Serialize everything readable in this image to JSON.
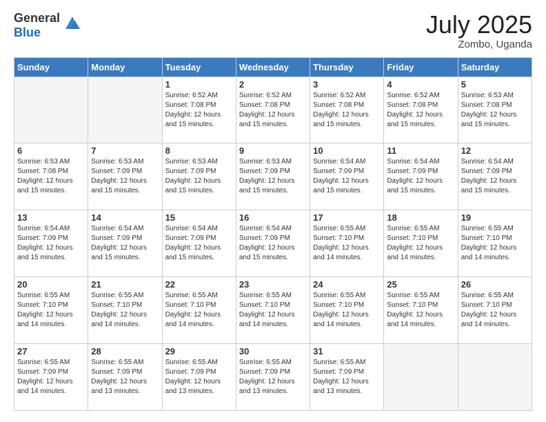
{
  "header": {
    "logo_general": "General",
    "logo_blue": "Blue",
    "month": "July 2025",
    "location": "Zombo, Uganda"
  },
  "days_of_week": [
    "Sunday",
    "Monday",
    "Tuesday",
    "Wednesday",
    "Thursday",
    "Friday",
    "Saturday"
  ],
  "weeks": [
    [
      {
        "day": "",
        "sunrise": "",
        "sunset": "",
        "daylight": ""
      },
      {
        "day": "",
        "sunrise": "",
        "sunset": "",
        "daylight": ""
      },
      {
        "day": "1",
        "sunrise": "Sunrise: 6:52 AM",
        "sunset": "Sunset: 7:08 PM",
        "daylight": "Daylight: 12 hours and 15 minutes."
      },
      {
        "day": "2",
        "sunrise": "Sunrise: 6:52 AM",
        "sunset": "Sunset: 7:08 PM",
        "daylight": "Daylight: 12 hours and 15 minutes."
      },
      {
        "day": "3",
        "sunrise": "Sunrise: 6:52 AM",
        "sunset": "Sunset: 7:08 PM",
        "daylight": "Daylight: 12 hours and 15 minutes."
      },
      {
        "day": "4",
        "sunrise": "Sunrise: 6:52 AM",
        "sunset": "Sunset: 7:08 PM",
        "daylight": "Daylight: 12 hours and 15 minutes."
      },
      {
        "day": "5",
        "sunrise": "Sunrise: 6:53 AM",
        "sunset": "Sunset: 7:08 PM",
        "daylight": "Daylight: 12 hours and 15 minutes."
      }
    ],
    [
      {
        "day": "6",
        "sunrise": "Sunrise: 6:53 AM",
        "sunset": "Sunset: 7:08 PM",
        "daylight": "Daylight: 12 hours and 15 minutes."
      },
      {
        "day": "7",
        "sunrise": "Sunrise: 6:53 AM",
        "sunset": "Sunset: 7:09 PM",
        "daylight": "Daylight: 12 hours and 15 minutes."
      },
      {
        "day": "8",
        "sunrise": "Sunrise: 6:53 AM",
        "sunset": "Sunset: 7:09 PM",
        "daylight": "Daylight: 12 hours and 15 minutes."
      },
      {
        "day": "9",
        "sunrise": "Sunrise: 6:53 AM",
        "sunset": "Sunset: 7:09 PM",
        "daylight": "Daylight: 12 hours and 15 minutes."
      },
      {
        "day": "10",
        "sunrise": "Sunrise: 6:54 AM",
        "sunset": "Sunset: 7:09 PM",
        "daylight": "Daylight: 12 hours and 15 minutes."
      },
      {
        "day": "11",
        "sunrise": "Sunrise: 6:54 AM",
        "sunset": "Sunset: 7:09 PM",
        "daylight": "Daylight: 12 hours and 15 minutes."
      },
      {
        "day": "12",
        "sunrise": "Sunrise: 6:54 AM",
        "sunset": "Sunset: 7:09 PM",
        "daylight": "Daylight: 12 hours and 15 minutes."
      }
    ],
    [
      {
        "day": "13",
        "sunrise": "Sunrise: 6:54 AM",
        "sunset": "Sunset: 7:09 PM",
        "daylight": "Daylight: 12 hours and 15 minutes."
      },
      {
        "day": "14",
        "sunrise": "Sunrise: 6:54 AM",
        "sunset": "Sunset: 7:09 PM",
        "daylight": "Daylight: 12 hours and 15 minutes."
      },
      {
        "day": "15",
        "sunrise": "Sunrise: 6:54 AM",
        "sunset": "Sunset: 7:09 PM",
        "daylight": "Daylight: 12 hours and 15 minutes."
      },
      {
        "day": "16",
        "sunrise": "Sunrise: 6:54 AM",
        "sunset": "Sunset: 7:09 PM",
        "daylight": "Daylight: 12 hours and 15 minutes."
      },
      {
        "day": "17",
        "sunrise": "Sunrise: 6:55 AM",
        "sunset": "Sunset: 7:10 PM",
        "daylight": "Daylight: 12 hours and 14 minutes."
      },
      {
        "day": "18",
        "sunrise": "Sunrise: 6:55 AM",
        "sunset": "Sunset: 7:10 PM",
        "daylight": "Daylight: 12 hours and 14 minutes."
      },
      {
        "day": "19",
        "sunrise": "Sunrise: 6:55 AM",
        "sunset": "Sunset: 7:10 PM",
        "daylight": "Daylight: 12 hours and 14 minutes."
      }
    ],
    [
      {
        "day": "20",
        "sunrise": "Sunrise: 6:55 AM",
        "sunset": "Sunset: 7:10 PM",
        "daylight": "Daylight: 12 hours and 14 minutes."
      },
      {
        "day": "21",
        "sunrise": "Sunrise: 6:55 AM",
        "sunset": "Sunset: 7:10 PM",
        "daylight": "Daylight: 12 hours and 14 minutes."
      },
      {
        "day": "22",
        "sunrise": "Sunrise: 6:55 AM",
        "sunset": "Sunset: 7:10 PM",
        "daylight": "Daylight: 12 hours and 14 minutes."
      },
      {
        "day": "23",
        "sunrise": "Sunrise: 6:55 AM",
        "sunset": "Sunset: 7:10 PM",
        "daylight": "Daylight: 12 hours and 14 minutes."
      },
      {
        "day": "24",
        "sunrise": "Sunrise: 6:55 AM",
        "sunset": "Sunset: 7:10 PM",
        "daylight": "Daylight: 12 hours and 14 minutes."
      },
      {
        "day": "25",
        "sunrise": "Sunrise: 6:55 AM",
        "sunset": "Sunset: 7:10 PM",
        "daylight": "Daylight: 12 hours and 14 minutes."
      },
      {
        "day": "26",
        "sunrise": "Sunrise: 6:55 AM",
        "sunset": "Sunset: 7:10 PM",
        "daylight": "Daylight: 12 hours and 14 minutes."
      }
    ],
    [
      {
        "day": "27",
        "sunrise": "Sunrise: 6:55 AM",
        "sunset": "Sunset: 7:09 PM",
        "daylight": "Daylight: 12 hours and 14 minutes."
      },
      {
        "day": "28",
        "sunrise": "Sunrise: 6:55 AM",
        "sunset": "Sunset: 7:09 PM",
        "daylight": "Daylight: 12 hours and 13 minutes."
      },
      {
        "day": "29",
        "sunrise": "Sunrise: 6:55 AM",
        "sunset": "Sunset: 7:09 PM",
        "daylight": "Daylight: 12 hours and 13 minutes."
      },
      {
        "day": "30",
        "sunrise": "Sunrise: 6:55 AM",
        "sunset": "Sunset: 7:09 PM",
        "daylight": "Daylight: 12 hours and 13 minutes."
      },
      {
        "day": "31",
        "sunrise": "Sunrise: 6:55 AM",
        "sunset": "Sunset: 7:09 PM",
        "daylight": "Daylight: 12 hours and 13 minutes."
      },
      {
        "day": "",
        "sunrise": "",
        "sunset": "",
        "daylight": ""
      },
      {
        "day": "",
        "sunrise": "",
        "sunset": "",
        "daylight": ""
      }
    ]
  ]
}
